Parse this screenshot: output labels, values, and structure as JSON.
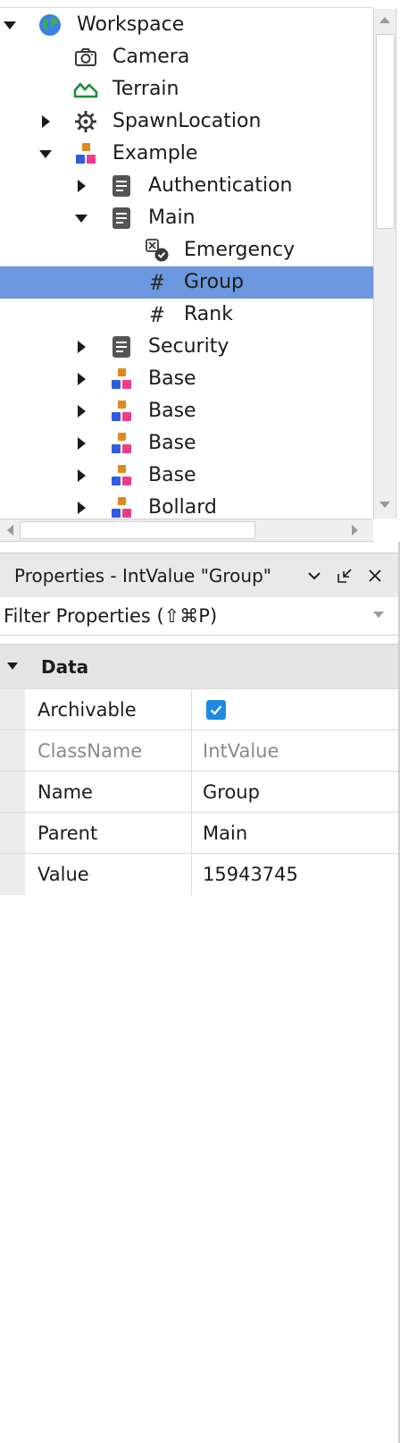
{
  "explorer": {
    "items": [
      {
        "label": "Workspace",
        "icon": "globe-icon",
        "expanded": true,
        "hasChildren": true,
        "depth": 0
      },
      {
        "label": "Camera",
        "icon": "camera-icon",
        "hasChildren": false,
        "depth": 1
      },
      {
        "label": "Terrain",
        "icon": "terrain-icon",
        "hasChildren": false,
        "depth": 1
      },
      {
        "label": "SpawnLocation",
        "icon": "spawn-location-icon",
        "expanded": false,
        "hasChildren": true,
        "depth": 1
      },
      {
        "label": "Example",
        "icon": "model-icon",
        "expanded": true,
        "hasChildren": true,
        "depth": 1
      },
      {
        "label": "Authentication",
        "icon": "script-icon",
        "expanded": false,
        "hasChildren": true,
        "depth": 2
      },
      {
        "label": "Main",
        "icon": "script-icon",
        "expanded": true,
        "hasChildren": true,
        "depth": 2
      },
      {
        "label": "Emergency",
        "icon": "bool-value-icon",
        "hasChildren": false,
        "depth": 3
      },
      {
        "label": "Group",
        "icon": "int-value-icon",
        "hasChildren": false,
        "depth": 3,
        "selected": true
      },
      {
        "label": "Rank",
        "icon": "int-value-icon",
        "hasChildren": false,
        "depth": 3
      },
      {
        "label": "Security",
        "icon": "script-icon",
        "expanded": false,
        "hasChildren": true,
        "depth": 2
      },
      {
        "label": "Base",
        "icon": "model-icon",
        "expanded": false,
        "hasChildren": true,
        "depth": 2
      },
      {
        "label": "Base",
        "icon": "model-icon",
        "expanded": false,
        "hasChildren": true,
        "depth": 2
      },
      {
        "label": "Base",
        "icon": "model-icon",
        "expanded": false,
        "hasChildren": true,
        "depth": 2
      },
      {
        "label": "Base",
        "icon": "model-icon",
        "expanded": false,
        "hasChildren": true,
        "depth": 2
      },
      {
        "label": "Bollard",
        "icon": "model-icon",
        "expanded": false,
        "hasChildren": true,
        "depth": 2
      }
    ]
  },
  "properties": {
    "title": "Properties - IntValue \"Group\"",
    "filter_placeholder": "Filter Properties (⇧⌘P)",
    "group": "Data",
    "rows": [
      {
        "name": "Archivable",
        "value": "",
        "checked": true,
        "readonly": false
      },
      {
        "name": "ClassName",
        "value": "IntValue",
        "readonly": true
      },
      {
        "name": "Name",
        "value": "Group",
        "readonly": false
      },
      {
        "name": "Parent",
        "value": "Main",
        "readonly": false
      },
      {
        "name": "Value",
        "value": "15943745",
        "readonly": false
      }
    ]
  },
  "colors": {
    "selection": "#6b98de",
    "checkbox": "#1e88e5",
    "header_bg": "#e9e9e9"
  }
}
